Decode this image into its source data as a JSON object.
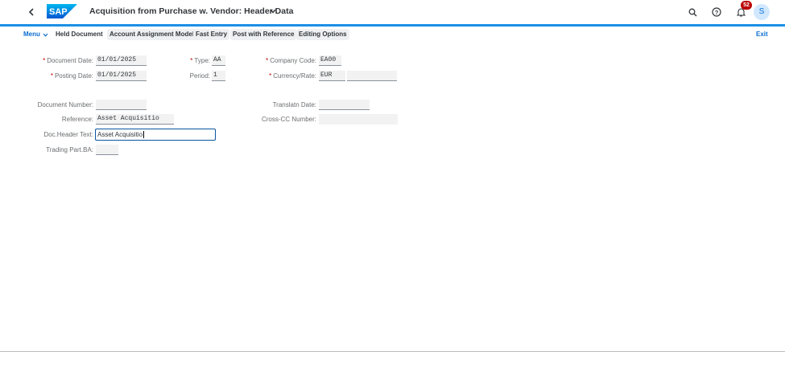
{
  "shell": {
    "title": "Acquisition from Purchase w. Vendor: Header Data",
    "notification_count": "52",
    "avatar_initial": "S",
    "accent_color": "#1b90e6"
  },
  "toolbar": {
    "menu_label": "Menu",
    "buttons": [
      "Held Document",
      "Account Assignment Model",
      "Fast Entry",
      "Post with Reference",
      "Editing Options"
    ],
    "exit_label": "Exit"
  },
  "form": {
    "document_date": {
      "label": "Document Date:",
      "value": "01/01/2025"
    },
    "posting_date": {
      "label": "Posting Date:",
      "value": "01/01/2025"
    },
    "type": {
      "label": "Type:",
      "value": "AA"
    },
    "period": {
      "label": "Period:",
      "value": "1"
    },
    "company_code": {
      "label": "Company Code:",
      "value": "EA00"
    },
    "currency_rate": {
      "label": "Currency/Rate:",
      "value": "EUR",
      "rate": ""
    },
    "document_number": {
      "label": "Document Number:",
      "value": ""
    },
    "reference": {
      "label": "Reference:",
      "value": "Asset Acquisitio"
    },
    "doc_header_text": {
      "label": "Doc.Header Text:",
      "value": "Asset Acquisitio"
    },
    "trading_part_ba": {
      "label": "Trading Part.BA:",
      "value": ""
    },
    "translatn_date": {
      "label": "Translatn Date:",
      "value": ""
    },
    "cross_cc_number": {
      "label": "Cross-CC Number:",
      "value": ""
    }
  }
}
